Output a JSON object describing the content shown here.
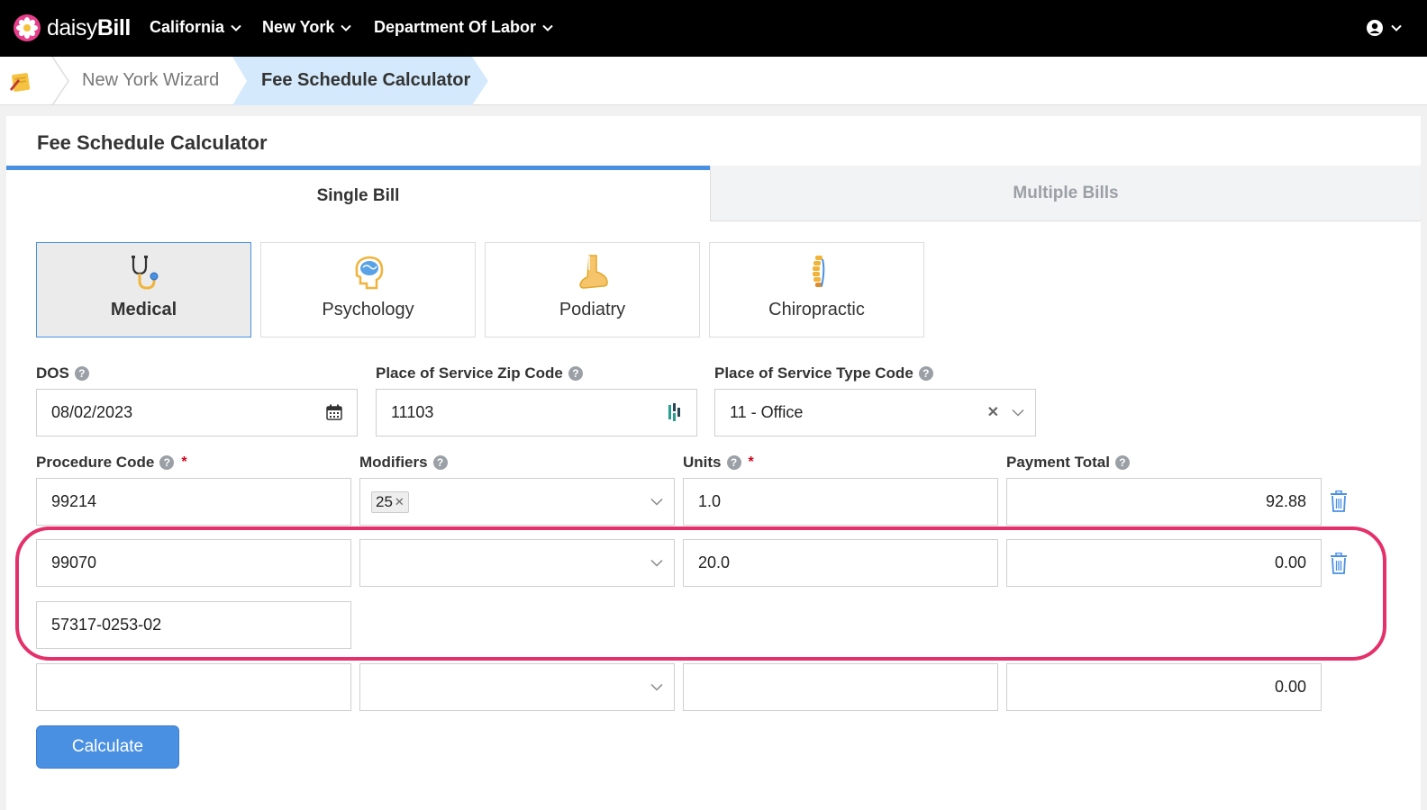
{
  "brand": {
    "name_thin": "daisy",
    "name_bold": "Bill"
  },
  "nav": {
    "items": [
      {
        "label": "California"
      },
      {
        "label": "New York"
      },
      {
        "label": "Department Of Labor"
      }
    ]
  },
  "breadcrumb": {
    "items": [
      "New York Wizard"
    ],
    "active": "Fee Schedule Calculator"
  },
  "panel": {
    "title": "Fee Schedule Calculator"
  },
  "tabs": {
    "single": "Single Bill",
    "multiple": "Multiple Bills"
  },
  "bill_types": [
    {
      "label": "Medical",
      "icon": "stethoscope-icon",
      "selected": true
    },
    {
      "label": "Psychology",
      "icon": "brain-icon",
      "selected": false
    },
    {
      "label": "Podiatry",
      "icon": "foot-icon",
      "selected": false
    },
    {
      "label": "Chiropractic",
      "icon": "spine-icon",
      "selected": false
    }
  ],
  "form": {
    "dos": {
      "label": "DOS",
      "value": "08/02/2023"
    },
    "zip": {
      "label": "Place of Service Zip Code",
      "value": "11103"
    },
    "pos_type": {
      "label": "Place of Service Type Code",
      "value": "11 - Office"
    },
    "columns": {
      "procedure": "Procedure Code",
      "modifiers": "Modifiers",
      "units": "Units",
      "payment": "Payment Total"
    },
    "required_mark": "*",
    "help_glyph": "?",
    "rows": [
      {
        "procedure": "99214",
        "modifier_tag": "25",
        "units": "1.0",
        "payment": "92.88"
      },
      {
        "procedure": "99070",
        "modifier_tag": "",
        "units": "20.0",
        "payment": "0.00",
        "ndc": "57317-0253-02"
      },
      {
        "procedure": "",
        "modifier_tag": "",
        "units": "",
        "payment": "0.00"
      }
    ]
  },
  "actions": {
    "calculate": "Calculate"
  },
  "colors": {
    "accent": "#4a90e2",
    "highlight": "#e4306b",
    "topbar": "#000000"
  }
}
